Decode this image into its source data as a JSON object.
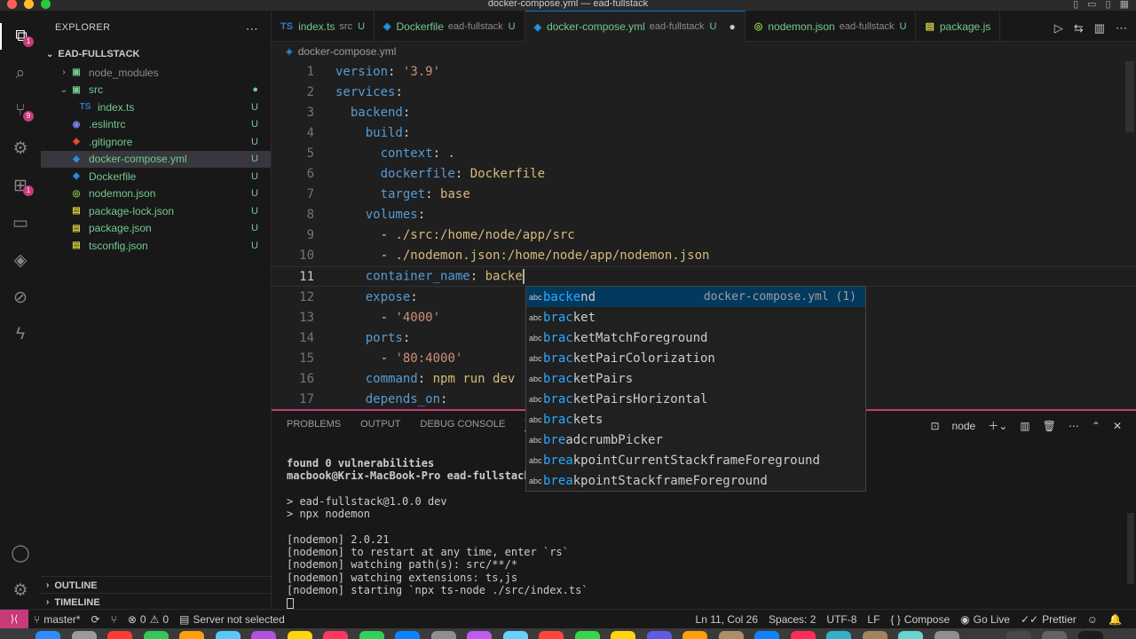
{
  "window": {
    "title": "docker-compose.yml — ead-fullstack"
  },
  "activity_bar": {
    "items": [
      {
        "name": "explorer-icon",
        "glyph": "⧉",
        "badge": "1"
      },
      {
        "name": "search-icon",
        "glyph": "⌕",
        "badge": ""
      },
      {
        "name": "source-control-icon",
        "glyph": "⑂",
        "badge": "9"
      },
      {
        "name": "run-debug-icon",
        "glyph": "⚙",
        "badge": ""
      },
      {
        "name": "extensions-icon",
        "glyph": "⊞",
        "badge": "1"
      },
      {
        "name": "remote-explorer-icon",
        "glyph": "▭",
        "badge": ""
      },
      {
        "name": "docker-icon",
        "glyph": "◈",
        "badge": ""
      },
      {
        "name": "git-graph-icon",
        "glyph": "⊘",
        "badge": ""
      },
      {
        "name": "thunder-client-icon",
        "glyph": "ϟ",
        "badge": ""
      }
    ],
    "bottom": [
      {
        "name": "account-icon",
        "glyph": "◯"
      },
      {
        "name": "manage-gear-icon",
        "glyph": "⚙"
      }
    ]
  },
  "explorer": {
    "title": "EXPLORER",
    "root": "EAD-FULLSTACK",
    "items": [
      {
        "label": "node_modules",
        "chev": "›",
        "icon": "▣",
        "icon_color": "#73c991",
        "indent": 20,
        "status": "",
        "style": "gray"
      },
      {
        "label": "src",
        "chev": "⌄",
        "icon": "▣",
        "icon_color": "#73c991",
        "indent": 20,
        "status": "●",
        "style": "green"
      },
      {
        "label": "index.ts",
        "chev": "",
        "icon": "TS",
        "icon_color": "#3178c6",
        "indent": 42,
        "status": "U",
        "style": "green"
      },
      {
        "label": ".eslintrc",
        "chev": "",
        "icon": "◉",
        "icon_color": "#8080f2",
        "indent": 32,
        "status": "U",
        "style": "green"
      },
      {
        "label": ".gitignore",
        "chev": "",
        "icon": "◆",
        "icon_color": "#e44d2b",
        "indent": 32,
        "status": "U",
        "style": "green"
      },
      {
        "label": "docker-compose.yml",
        "chev": "",
        "icon": "◈",
        "icon_color": "#2496ed",
        "indent": 32,
        "status": "U",
        "style": "green",
        "selected": true
      },
      {
        "label": "Dockerfile",
        "chev": "",
        "icon": "◈",
        "icon_color": "#2496ed",
        "indent": 32,
        "status": "U",
        "style": "green"
      },
      {
        "label": "nodemon.json",
        "chev": "",
        "icon": "◎",
        "icon_color": "#8bc34a",
        "indent": 32,
        "status": "U",
        "style": "green"
      },
      {
        "label": "package-lock.json",
        "chev": "",
        "icon": "▤",
        "icon_color": "#cbcb41",
        "indent": 32,
        "status": "U",
        "style": "green"
      },
      {
        "label": "package.json",
        "chev": "",
        "icon": "▤",
        "icon_color": "#cbcb41",
        "indent": 32,
        "status": "U",
        "style": "green"
      },
      {
        "label": "tsconfig.json",
        "chev": "",
        "icon": "▤",
        "icon_color": "#cbcb41",
        "indent": 32,
        "status": "U",
        "style": "green"
      }
    ],
    "outline": "OUTLINE",
    "timeline": "TIMELINE"
  },
  "tabs": [
    {
      "label": "index.ts",
      "desc": "src",
      "mark": "U",
      "icon": "TS",
      "icon_color": "#3178c6",
      "active": false
    },
    {
      "label": "Dockerfile",
      "desc": "ead-fullstack",
      "mark": "U",
      "icon": "◈",
      "icon_color": "#2496ed",
      "active": false
    },
    {
      "label": "docker-compose.yml",
      "desc": "ead-fullstack",
      "mark": "U",
      "icon": "◈",
      "icon_color": "#2496ed",
      "active": true,
      "dirty": "●"
    },
    {
      "label": "nodemon.json",
      "desc": "ead-fullstack",
      "mark": "U",
      "icon": "◎",
      "icon_color": "#8bc34a",
      "active": false
    },
    {
      "label": "package.js",
      "desc": "",
      "mark": "",
      "icon": "▤",
      "icon_color": "#cbcb41",
      "active": false
    }
  ],
  "breadcrumb": "docker-compose.yml",
  "editor": {
    "current_line": 11,
    "lines": [
      {
        "n": "1",
        "ind": 0,
        "key": "version",
        "val": "'3.9'",
        "vtype": "s"
      },
      {
        "n": "2",
        "ind": 0,
        "key": "services",
        "val": "",
        "vtype": ""
      },
      {
        "n": "3",
        "ind": 1,
        "key": "backend",
        "val": "",
        "vtype": ""
      },
      {
        "n": "4",
        "ind": 2,
        "key": "build",
        "val": "",
        "vtype": ""
      },
      {
        "n": "5",
        "ind": 3,
        "key": "context",
        "val": ".",
        "vtype": "y"
      },
      {
        "n": "6",
        "ind": 3,
        "key": "dockerfile",
        "val": "Dockerfile",
        "vtype": "y"
      },
      {
        "n": "7",
        "ind": 3,
        "key": "target",
        "val": "base",
        "vtype": "y"
      },
      {
        "n": "8",
        "ind": 2,
        "key": "volumes",
        "val": "",
        "vtype": ""
      },
      {
        "n": "9",
        "ind": 3,
        "key": "",
        "dash": true,
        "val": "./src:/home/node/app/src",
        "vtype": "y"
      },
      {
        "n": "10",
        "ind": 3,
        "key": "",
        "dash": true,
        "val": "./nodemon.json:/home/node/app/nodemon.json",
        "vtype": "y"
      },
      {
        "n": "11",
        "ind": 2,
        "key": "container_name",
        "val": "backe",
        "vtype": "y",
        "caret": true
      },
      {
        "n": "12",
        "ind": 2,
        "key": "expose",
        "val": "",
        "vtype": ""
      },
      {
        "n": "13",
        "ind": 3,
        "key": "",
        "dash": true,
        "val": "'4000'",
        "vtype": "s"
      },
      {
        "n": "14",
        "ind": 2,
        "key": "ports",
        "val": "",
        "vtype": ""
      },
      {
        "n": "15",
        "ind": 3,
        "key": "",
        "dash": true,
        "val": "'80:4000'",
        "vtype": "s"
      },
      {
        "n": "16",
        "ind": 2,
        "key": "command",
        "val": "npm run dev",
        "vtype": "y"
      },
      {
        "n": "17",
        "ind": 2,
        "key": "depends_on",
        "val": "",
        "vtype": ""
      }
    ]
  },
  "suggestions": [
    {
      "match": "backe",
      "rest": "nd",
      "detail": "docker-compose.yml (1)",
      "selected": true
    },
    {
      "match": "brac",
      "rest": "ket",
      "detail": ""
    },
    {
      "match": "brac",
      "rest": "ketMatchForeground",
      "detail": ""
    },
    {
      "match": "brac",
      "rest": "ketPairColorization",
      "detail": ""
    },
    {
      "match": "brac",
      "rest": "ketPairs",
      "detail": ""
    },
    {
      "match": "brac",
      "rest": "ketPairsHorizontal",
      "detail": ""
    },
    {
      "match": "brac",
      "rest": "kets",
      "detail": ""
    },
    {
      "match": "bre",
      "rest": "adcrumbPicker",
      "detail": ""
    },
    {
      "match": "brea",
      "rest": "kpointCurrentStackframeForeground",
      "detail": ""
    },
    {
      "match": "brea",
      "rest": "kpointStackframeForeground",
      "detail": ""
    }
  ],
  "suggestion_abc": "abc",
  "panel": {
    "tabs": [
      "PROBLEMS",
      "OUTPUT",
      "DEBUG CONSOLE",
      "TERMINAL"
    ],
    "active_tab": "TERMINAL",
    "terminal_name": "node",
    "lines": [
      {
        "text": "found 0 vulnerabilities",
        "bold": true
      },
      {
        "text": "macbook@Krix-MacBook-Pro ead-fullstack %",
        "bold": true
      },
      {
        "text": "",
        "bold": false
      },
      {
        "text": "> ead-fullstack@1.0.0 dev",
        "bold": false
      },
      {
        "text": "> npx nodemon",
        "bold": false
      },
      {
        "text": "",
        "bold": false
      },
      {
        "text": "[nodemon] 2.0.21",
        "bold": false
      },
      {
        "text": "[nodemon] to restart at any time, enter `rs`",
        "bold": false
      },
      {
        "text": "[nodemon] watching path(s): src/**/*",
        "bold": false
      },
      {
        "text": "[nodemon] watching extensions: ts,js",
        "bold": false
      },
      {
        "text": "[nodemon] starting `npx ts-node ./src/index.ts`",
        "bold": false
      }
    ]
  },
  "statusbar": {
    "branch": "master*",
    "errors": "0",
    "warnings": "0",
    "server": "Server not selected",
    "position": "Ln 11, Col 26",
    "spaces": "Spaces: 2",
    "encoding": "UTF-8",
    "eol": "LF",
    "language": "Compose",
    "golive": "Go Live",
    "prettier": "Prettier"
  },
  "colors": {
    "accent": "#0078d4",
    "remote": "#c83a7a",
    "untracked": "#73c991",
    "suggest_highlight": "#2aaaff"
  }
}
